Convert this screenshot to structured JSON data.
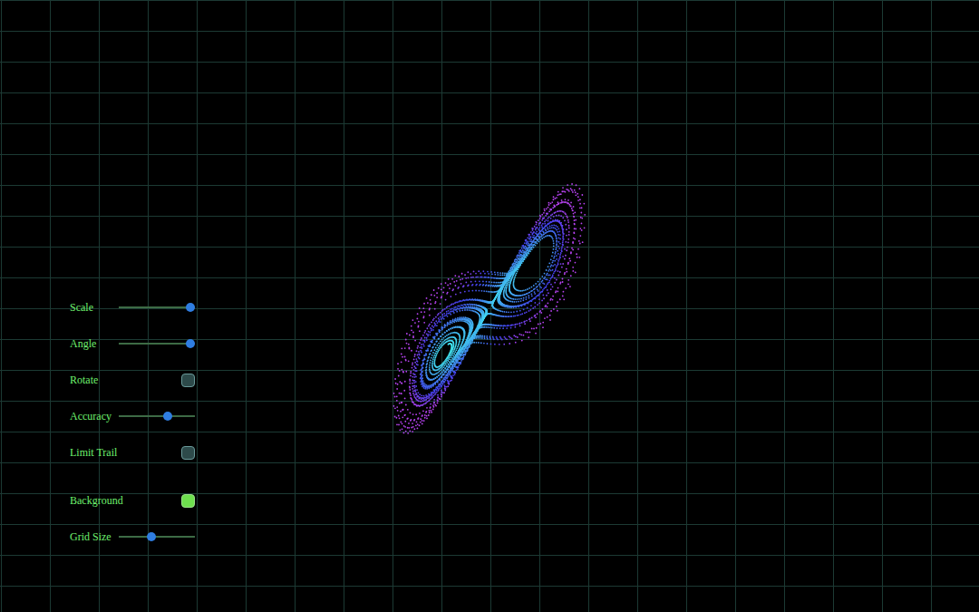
{
  "controls": [
    {
      "label": "Scale",
      "kind": "slider",
      "level": 0.94
    },
    {
      "label": "Angle",
      "kind": "slider",
      "level": 0.94
    },
    {
      "label": "Rotate",
      "kind": "checkbox",
      "checked": false
    },
    {
      "label": "Accuracy",
      "kind": "slider",
      "level": 0.64
    },
    {
      "label": "Limit Trail",
      "kind": "checkbox",
      "checked": false
    }
  ],
  "display_controls": [
    {
      "label": "Background",
      "kind": "checkbox",
      "checked": true
    },
    {
      "label": "Grid Size",
      "kind": "slider",
      "level": 0.43
    }
  ]
}
